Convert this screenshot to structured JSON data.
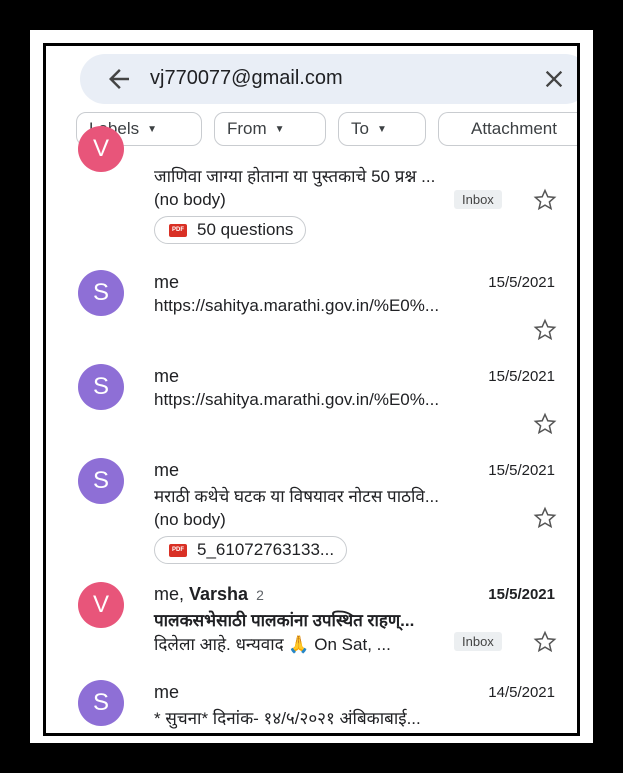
{
  "search": {
    "query": "vj770077@gmail.com"
  },
  "filters": [
    "Labels",
    "From",
    "To",
    "Attachment"
  ],
  "emails": [
    {
      "avatar": "V",
      "avatar_color": "#e8557a",
      "subject": "जाणिवा जाग्या होताना या पुस्तकाचे 50 प्रश्न ...",
      "snippet": "(no body)",
      "badge": "Inbox",
      "attachment": "50 questions"
    },
    {
      "avatar": "S",
      "avatar_color": "#8e6fd6",
      "sender": "me",
      "date": "15/5/2021",
      "subject": "https://sahitya.marathi.gov.in/%E0%..."
    },
    {
      "avatar": "S",
      "avatar_color": "#8e6fd6",
      "sender": "me",
      "date": "15/5/2021",
      "subject": "https://sahitya.marathi.gov.in/%E0%..."
    },
    {
      "avatar": "S",
      "avatar_color": "#8e6fd6",
      "sender": "me",
      "date": "15/5/2021",
      "subject": "मराठी कथेचे घटक या विषयावर नोटस पाठवि...",
      "snippet": "(no body)",
      "attachment": "5_61072763133..."
    },
    {
      "avatar": "V",
      "avatar_color": "#e8557a",
      "sender": "me, ",
      "sender_bold": "Varsha",
      "count": "2",
      "date": "15/5/2021",
      "subject": "पालकसभेसाठी पालकांना  उपस्थित राहण्...",
      "snippet": "दिलेला आहे. धन्यवाद 🙏 On Sat, ...",
      "badge": "Inbox"
    },
    {
      "avatar": "S",
      "avatar_color": "#8e6fd6",
      "sender": "me",
      "date": "14/5/2021",
      "subject": "* सुचना* दिनांक- १४/५/२०२१ अंबिकाबाई..."
    }
  ],
  "icons": {
    "back": "arrow-left-icon",
    "close": "close-icon",
    "star": "star-outline-icon",
    "pdf": "pdf-icon"
  },
  "pdf_label": "PDF"
}
